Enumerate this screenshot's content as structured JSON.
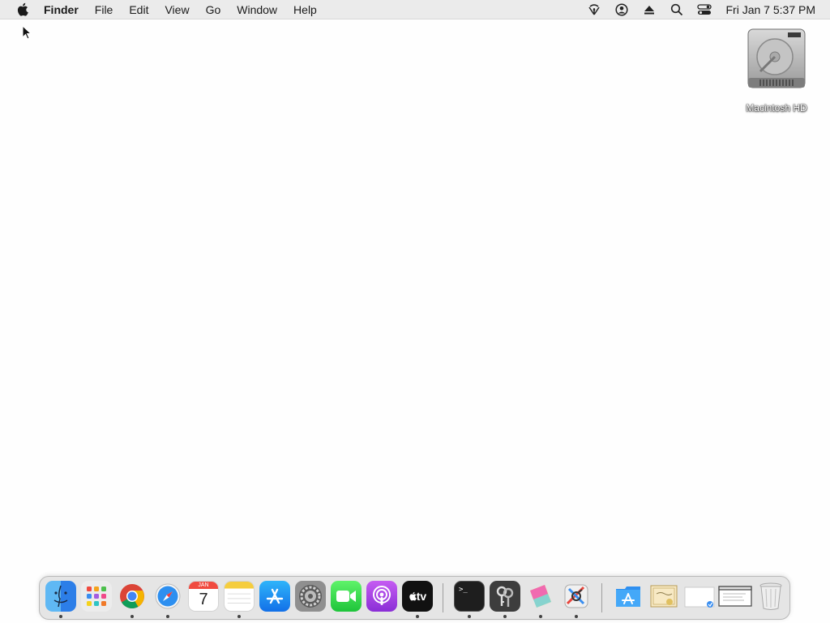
{
  "menubar": {
    "apple_icon": "apple-logo-icon",
    "app_name": "Finder",
    "menus": [
      "File",
      "Edit",
      "View",
      "Go",
      "Window",
      "Help"
    ],
    "status_icons": [
      "wifi-icon",
      "user-icon",
      "eject-icon",
      "spotlight-search-icon",
      "control-center-icon"
    ],
    "clock": "Fri Jan 7  5:37 PM"
  },
  "desktop": {
    "disk_label": "Macintosh HD"
  },
  "dock": {
    "calendar_month": "JAN",
    "calendar_day": "7",
    "tv_label": "tv",
    "terminal_prompt": ">_",
    "apps": [
      {
        "name": "Finder",
        "icon": "finder-icon",
        "running": true
      },
      {
        "name": "Launchpad",
        "icon": "launchpad-icon",
        "running": false
      },
      {
        "name": "Google Chrome",
        "icon": "chrome-icon",
        "running": true
      },
      {
        "name": "Safari",
        "icon": "safari-icon",
        "running": true
      },
      {
        "name": "Calendar",
        "icon": "calendar-icon",
        "running": false
      },
      {
        "name": "Notes",
        "icon": "notes-icon",
        "running": true
      },
      {
        "name": "App Store",
        "icon": "app-store-icon",
        "running": false
      },
      {
        "name": "System Preferences",
        "icon": "system-preferences-icon",
        "running": false
      },
      {
        "name": "FaceTime",
        "icon": "facetime-icon",
        "running": false
      },
      {
        "name": "Podcasts",
        "icon": "podcasts-icon",
        "running": false
      },
      {
        "name": "TV",
        "icon": "apple-tv-icon",
        "running": true
      },
      {
        "name": "Terminal",
        "icon": "terminal-icon",
        "running": true
      },
      {
        "name": "Keychain Access",
        "icon": "keychain-access-icon",
        "running": true
      },
      {
        "name": "ColorSync Utility",
        "icon": "colorsync-icon",
        "running": true
      },
      {
        "name": "System Information",
        "icon": "system-information-icon",
        "running": true
      },
      {
        "name": "Applications",
        "icon": "applications-folder-icon",
        "running": false
      },
      {
        "name": "Certificate",
        "icon": "certificate-document-icon",
        "running": false
      },
      {
        "name": "Document",
        "icon": "document-icon",
        "running": false
      },
      {
        "name": "Window",
        "icon": "window-screenshot-icon",
        "running": false
      },
      {
        "name": "Trash",
        "icon": "trash-icon",
        "running": false
      }
    ]
  }
}
